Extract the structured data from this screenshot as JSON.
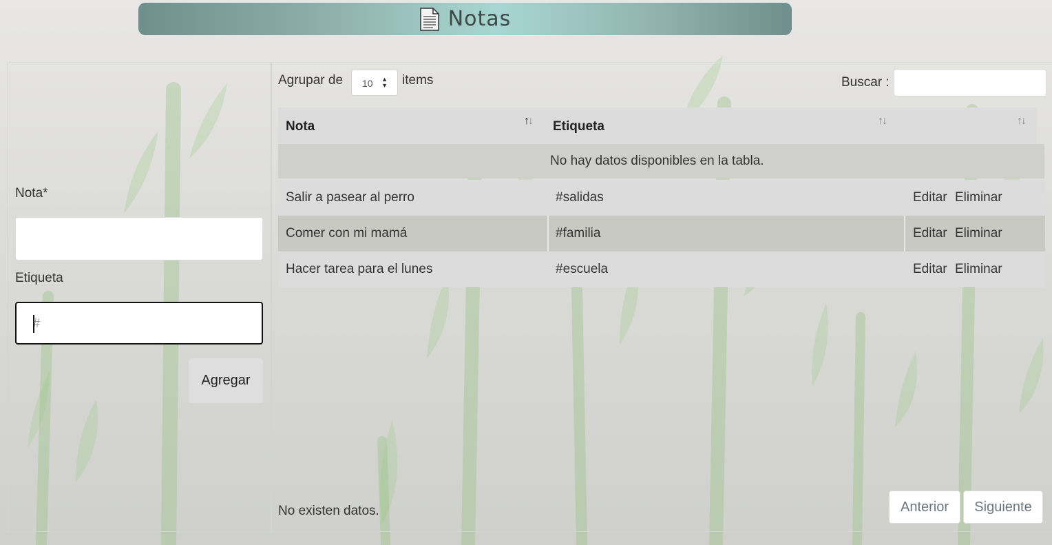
{
  "header": {
    "title": "Notas"
  },
  "form": {
    "note_label": "Nota*",
    "note_value": "",
    "tag_label": "Etiqueta",
    "tag_placeholder": "#",
    "add_button": "Agregar"
  },
  "table_controls": {
    "group_prefix": "Agrupar de",
    "group_value": "10",
    "group_suffix": "items",
    "search_label": "Buscar :",
    "search_value": ""
  },
  "table": {
    "columns": [
      "Nota",
      "Etiqueta",
      ""
    ],
    "empty_message": "No hay datos disponibles en la tabla.",
    "rows": [
      {
        "nota": "Salir a pasear al perro",
        "etiqueta": "#salidas",
        "edit": "Editar",
        "delete": "Eliminar"
      },
      {
        "nota": "Comer con mi mamá",
        "etiqueta": "#familia",
        "edit": "Editar",
        "delete": "Eliminar"
      },
      {
        "nota": "Hacer tarea para el lunes",
        "etiqueta": "#escuela",
        "edit": "Editar",
        "delete": "Eliminar"
      }
    ]
  },
  "footer": {
    "info": "No existen datos.",
    "prev": "Anterior",
    "next": "Siguiente"
  }
}
